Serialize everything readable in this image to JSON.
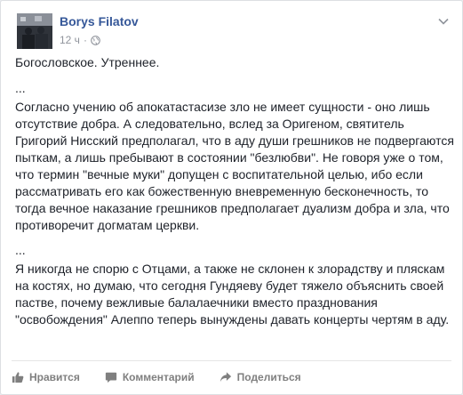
{
  "post": {
    "author": "Borys Filatov",
    "time": "12 ч",
    "audience_icon": "globe-icon",
    "paragraphs": [
      "Богословское. Утреннее.",
      "...",
      "Согласно учению об апокатастасизе зло не имеет сущности - оно лишь отсутствие добра. А следовательно, вслед за Оригеном, святитель Григорий Нисский предполагал, что в аду души грешников не подвергаются пыткам, а лишь пребывают в состоянии \"безлюбви\". Не говоря уже о том, что термин \"вечные муки\" допущен с воспитательной целью, ибо если рассматривать его как божественную вневременную бесконечность, то тогда вечное наказание грешников предполагает дуализм добра и зла, что противоречит догматам церкви.",
      "...",
      "Я никогда не спорю с Отцами, а также не склонен к злорадству и пляскам на костях, но думаю, что сегодня Гундяеву будет тяжело объяснить своей пастве, почему вежливые балалаечники вместо празднования \"освобождения\" Алеппо теперь вынуждены давать концерты чертям в аду."
    ]
  },
  "actions": {
    "like": "Нравится",
    "comment": "Комментарий",
    "share": "Поделиться"
  },
  "colors": {
    "author": "#365899",
    "text": "#1d2129",
    "muted": "#90949c",
    "action": "#7f7f7f"
  }
}
